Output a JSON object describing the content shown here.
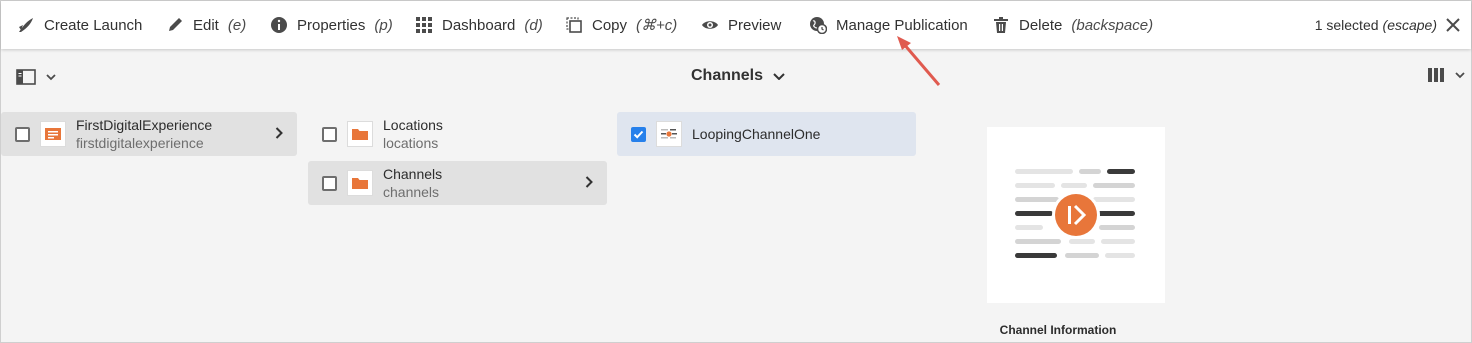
{
  "toolbar": {
    "actions": [
      {
        "label": "Create Launch",
        "shortcut": "",
        "icon": "launch-icon"
      },
      {
        "label": "Edit",
        "shortcut": "(e)",
        "icon": "pencil-icon"
      },
      {
        "label": "Properties",
        "shortcut": "(p)",
        "icon": "info-icon"
      },
      {
        "label": "Dashboard",
        "shortcut": "(d)",
        "icon": "dashboard-grid-icon"
      },
      {
        "label": "Copy",
        "shortcut": "(⌘+c)",
        "icon": "copy-icon"
      },
      {
        "label": "Preview",
        "shortcut": "",
        "icon": "eye-icon"
      },
      {
        "label": "Manage Publication",
        "shortcut": "",
        "icon": "globe-clock-icon"
      },
      {
        "label": "Delete",
        "shortcut": "(backspace)",
        "icon": "trash-icon"
      }
    ],
    "selection": {
      "count_label": "1 selected",
      "shortcut": "(escape)"
    }
  },
  "titlebar": {
    "breadcrumb": "Channels"
  },
  "columns": [
    {
      "items": [
        {
          "title": "FirstDigitalExperience",
          "subtitle": "firstdigitalexperience"
        }
      ]
    },
    {
      "items": [
        {
          "title": "Locations",
          "subtitle": "locations"
        },
        {
          "title": "Channels",
          "subtitle": "channels"
        }
      ]
    },
    {
      "items": [
        {
          "title": "LoopingChannelOne",
          "subtitle": ""
        }
      ]
    }
  ],
  "preview": {
    "caption": "Channel Information"
  },
  "colors": {
    "accent": "#2680eb",
    "folder": "#e8763a",
    "annotation_arrow": "#e05a4f"
  }
}
